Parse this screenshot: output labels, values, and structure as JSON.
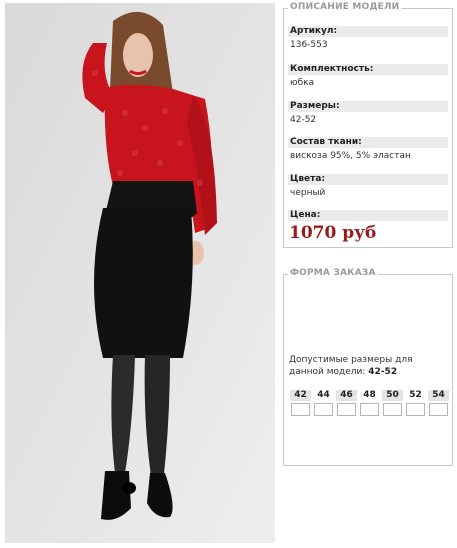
{
  "description": {
    "legend": "ОПИСАНИЕ МОДЕЛИ",
    "fields": [
      {
        "label": "Артикул:",
        "value": "136-553"
      },
      {
        "label": "Комплектность:",
        "value": "юбка"
      },
      {
        "label": "Размеры:",
        "value": "42-52"
      },
      {
        "label": "Состав ткани:",
        "value": "вискоза 95%, 5% эластан"
      },
      {
        "label": "Цвета:",
        "value": "черный"
      }
    ],
    "price_label": "Цена:",
    "price_value": "1070 руб"
  },
  "order": {
    "legend": "ФОРМА ЗАКАЗА",
    "sizes_text_line1": "Допустимые размеры для",
    "sizes_text_line2": "данной модели:",
    "sizes_range": "42-52",
    "sizes": [
      "42",
      "44",
      "46",
      "48",
      "50",
      "52",
      "54"
    ]
  },
  "colors": {
    "price": "#9d1a1a",
    "blouse": "#c8141c",
    "skirt": "#111111"
  }
}
